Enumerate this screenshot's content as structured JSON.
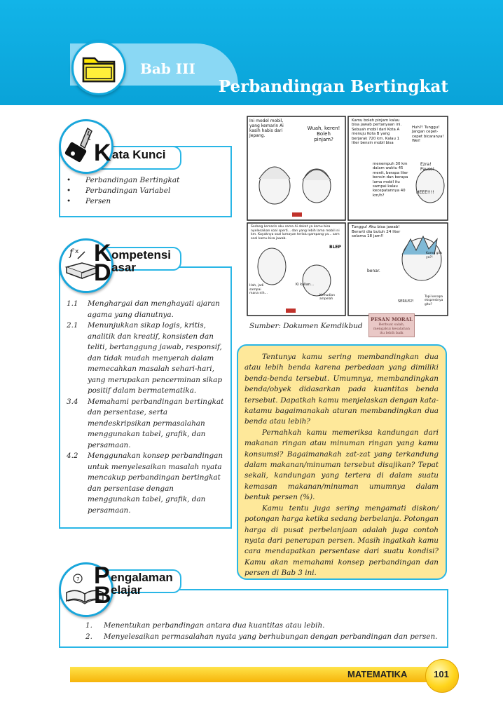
{
  "header": {
    "bab_label": "Bab  III",
    "chapter_title": "Perbandingan Bertingkat",
    "icon": "folder-icon"
  },
  "kata_kunci": {
    "initial": "K",
    "rest": "ata Kunci",
    "icon": "key-icon",
    "items": [
      "Perbandingan Bertingkat",
      "Perbandingan Variabel",
      "Persen"
    ]
  },
  "kompetensi_dasar": {
    "initial1": "K",
    "rest1": "ompetensi",
    "initial2": "D",
    "rest2": "asar",
    "icon": "book-formula-icon",
    "items": [
      {
        "num": "1.1",
        "text": "Menghargai dan menghayati ajaran agama yang dianutnya."
      },
      {
        "num": "2.1",
        "text": "Menunjukkan sikap logis, kritis, analitik dan kreatif, konsisten dan teliti, bertanggung jawab, responsif, dan tidak mudah menyerah dalam memecahkan masalah sehari-hari, yang merupakan pencerminan sikap positif dalam bermatematika."
      },
      {
        "num": "3.4",
        "text": "Memahami perbandingan bertingkat dan persentase, serta mendeskripsikan permasalahan menggunakan tabel, grafik, dan persamaan."
      },
      {
        "num": "4.2",
        "text": "Menggunakan konsep perbandingan untuk menyelesaikan masalah nyata mencakup perbandingan bertingkat dan persentase dengan menggunakan tabel, grafik, dan persamaan."
      }
    ]
  },
  "comic": {
    "source": "Sumber: Dokumen Kemdikbud",
    "stamp": {
      "title": "PESAN MORAL",
      "text": "Berbuat salah, mengakui kesalahan itu lebih baik"
    },
    "bubbles": [
      "Ini model mobil, yang kemarin Ai kasih habis dari Jepang.",
      "Wuah, keren! Boleh pinjam?",
      "Kamu boleh pinjam kalau bisa jawab pertanyaan ini. Sebuah mobil dari Kota A menuju Kota B yang berjarak 720 km. Kalau 1 liter bensin mobil bisa",
      "menempuh 30 km dalam waktu 45 menit, berapa liter bensin dan berapa lama mobil itu sampai kalau kecepatannya 40 km/h?",
      "Huh?! Tunggu! Jangan cepet-cepet bicaranya! Wei!",
      "Ezra! Pause!",
      "HEEE!!!!",
      "Sedang kemarin aku sama Ai dekat ya kamu bisa nyelesaikan soal sperti... dan yang lebih lama mobil ini km. Kayaknya soal lumayan terlalu gampang ya... sam soal kamu bisa jawab.",
      "BLEP",
      "Hah, jadi sampai mana nih...",
      "Ki kalian...",
      "Kemudian ampelah",
      "Tunggu! Aku bisa jawab! Berarti dia butuh 24 liter selama 18 jam!!",
      "Kamu gila ya?!",
      "benar.",
      "SERIUS?!",
      "Tapi kenapa ekspresinya gitu?"
    ]
  },
  "intro": {
    "paragraphs": [
      "Tentunya kamu sering membandingkan dua atau lebih benda karena perbedaan yang dimiliki benda-benda tersebut. Umumnya, membandingkan benda/obyek didasarkan pada kuantitas benda tersebut. Dapatkah kamu menjelaskan dengan kata-katamu bagaimanakah aturan membandingkan dua benda atau lebih?",
      "Pernahkah kamu memeriksa kandungan dari makanan ringan atau minuman ringan yang kamu konsumsi? Bagaimanakah zat-zat yang terkandung dalam makanan/minuman tersebut disajikan? Tepat sekali, kandungan yang tertera di dalam suatu kemasan makanan/minuman umumnya dalam bentuk persen (%).",
      "Kamu tentu juga sering mengamati diskon/ potongan harga ketika sedang berbelanja. Potongan harga di pusat perbelanjaan adalah juga contoh nyata dari penerapan persen. Masih ingatkah kamu cara mendapatkan persentase dari suatu kondisi? Kamu akan memahami konsep perbandingan dan persen di Bab 3 ini."
    ]
  },
  "pengalaman_belajar": {
    "initial1": "P",
    "rest1": "engalaman",
    "initial2": "B",
    "rest2": "elajar",
    "icon": "open-book-icon",
    "items": [
      {
        "num": "1.",
        "text": "Menentukan perbandingan antara dua kuantitas atau lebih."
      },
      {
        "num": "2.",
        "text": "Menyelesaikan permasalahan nyata yang berhubungan dengan perbandingan dan persen."
      }
    ]
  },
  "footer": {
    "subject": "MATEMATIKA",
    "page": "101"
  },
  "colors": {
    "header_blue": "#12b4e8",
    "panel_border": "#29b6e6",
    "yellow_box": "#fee89a",
    "footer_yellow": "#f6b40a"
  }
}
